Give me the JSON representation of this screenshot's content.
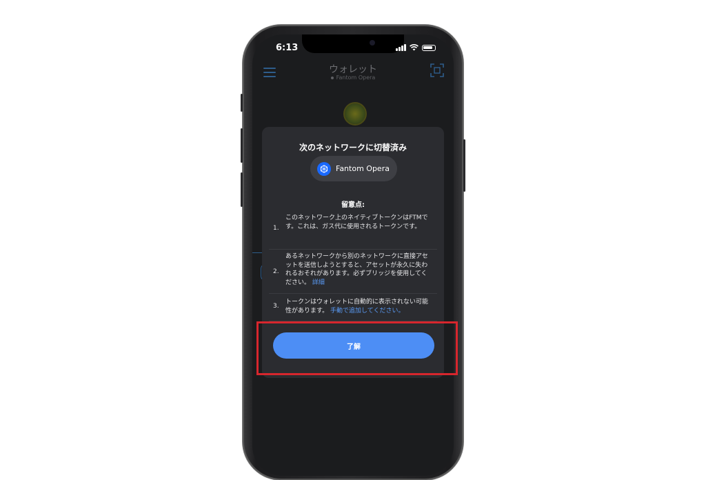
{
  "status_bar": {
    "time": "6:13"
  },
  "header": {
    "title": "ウォレット",
    "network": "Fantom Opera"
  },
  "modal": {
    "title": "次のネットワークに切替済み",
    "network_name": "Fantom Opera",
    "notes_title": "留意点:",
    "notes": [
      {
        "num": "1.",
        "text": "このネットワーク上のネイティブトークンはFTMです。これは、ガス代に使用されるトークンです。",
        "link": ""
      },
      {
        "num": "2.",
        "text": "あるネットワークから別のネットワークに直接アセットを送信しようとすると、アセットが永久に失われるおそれがあります。必ずブリッジを使用してください。",
        "link": "詳細"
      },
      {
        "num": "3.",
        "text": "トークンはウォレットに自動的に表示されない可能性があります。",
        "link": "手動で追加してください。"
      }
    ],
    "ok_label": "了解"
  },
  "colors": {
    "accent": "#4d8ef5",
    "highlight": "#d7262d",
    "modal_bg": "#2b2c30"
  },
  "icons": [
    "menu-icon",
    "scan-icon",
    "fantom-logo-icon",
    "signal-icon",
    "wifi-icon",
    "battery-icon"
  ]
}
